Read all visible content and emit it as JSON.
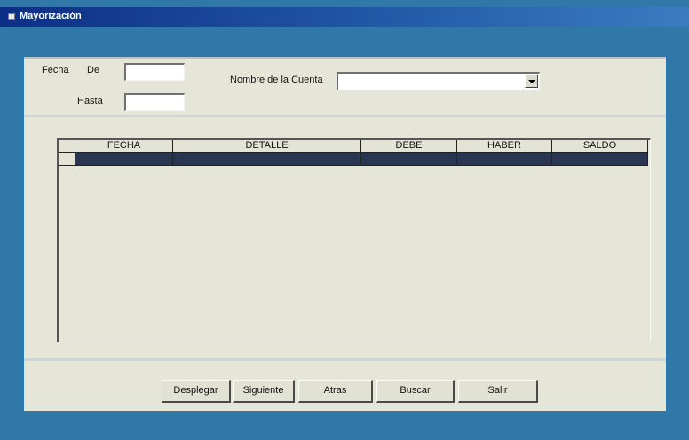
{
  "window": {
    "title": "Mayorización"
  },
  "filters": {
    "fecha_label": "Fecha",
    "de_label": "De",
    "hasta_label": "Hasta",
    "de_value": "",
    "hasta_value": "",
    "cuenta_label": "Nombre de la Cuenta",
    "cuenta_value": ""
  },
  "grid": {
    "columns": [
      "FECHA",
      "DETALLE",
      "DEBE",
      "HABER",
      "SALDO"
    ],
    "rows": [
      [
        "",
        "",
        "",
        "",
        ""
      ]
    ]
  },
  "buttons": {
    "desplegar": "Desplegar",
    "siguiente": "Siguiente",
    "atras": "Atras",
    "buscar": "Buscar",
    "salir": "Salir"
  },
  "colors": {
    "titlebar": "#0c2f86",
    "window_bg": "#2f78a8",
    "form_bg": "#e6e6d8",
    "selected_row": "#2a3550"
  }
}
